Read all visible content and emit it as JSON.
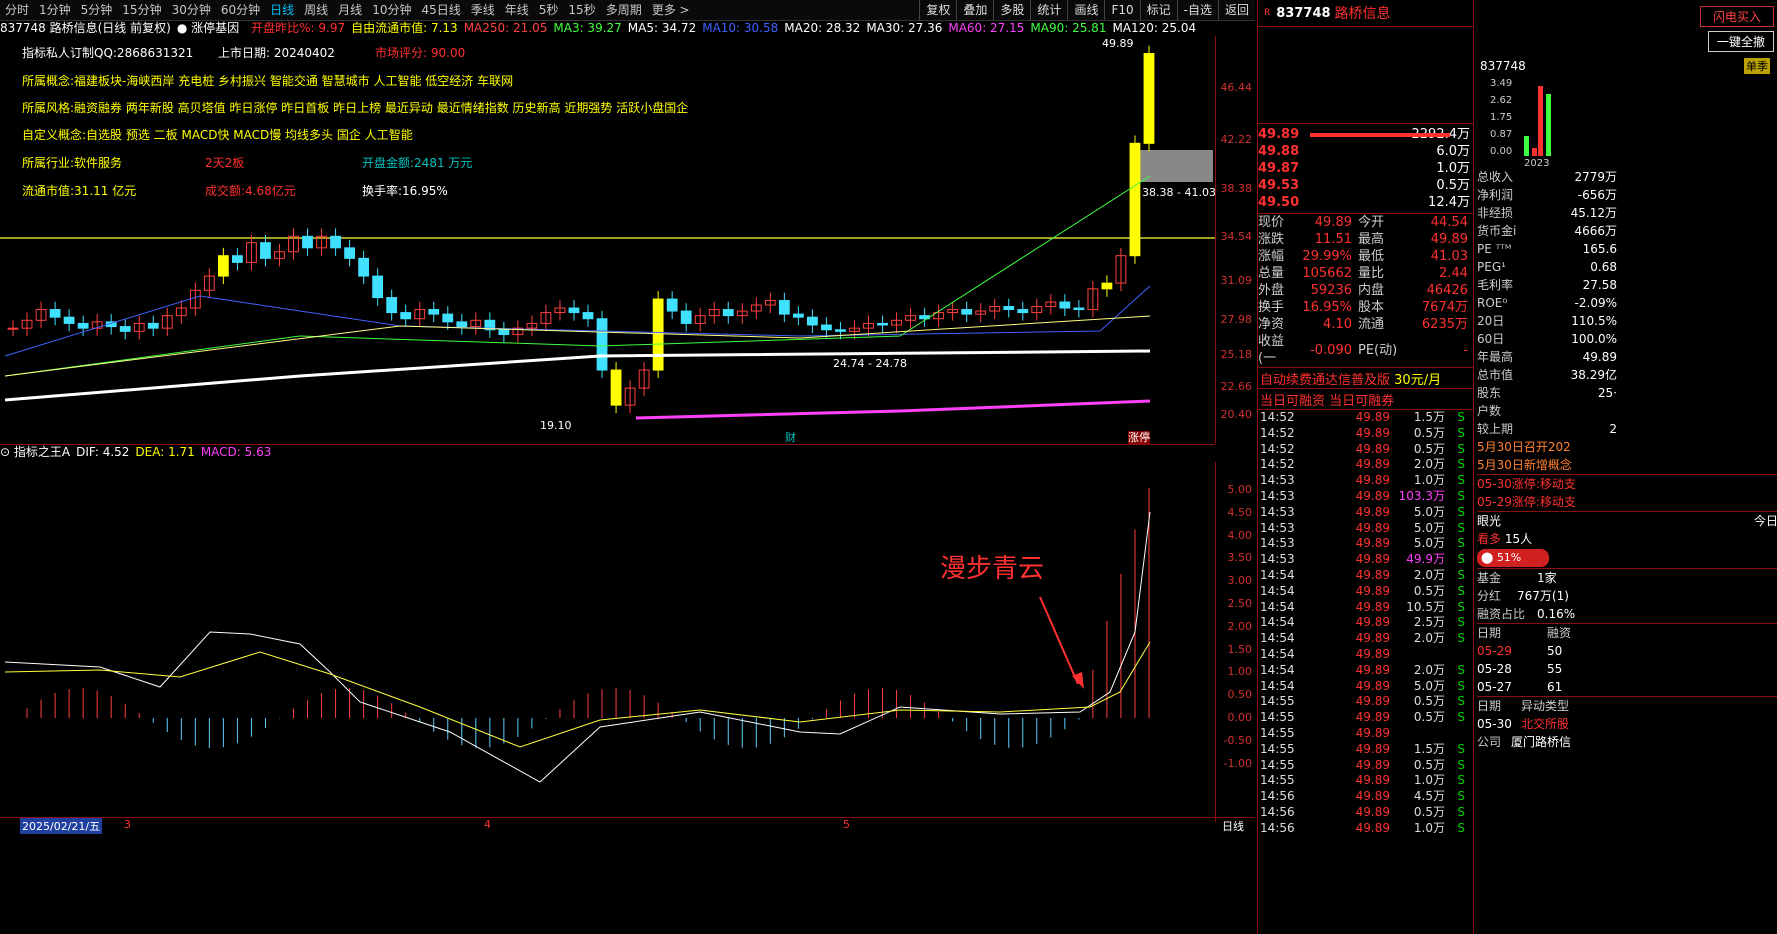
{
  "toolbar": {
    "periods": [
      "分时",
      "1分钟",
      "5分钟",
      "15分钟",
      "30分钟",
      "60分钟",
      "日线",
      "周线",
      "月线",
      "10分钟",
      "45日线",
      "季线",
      "年线",
      "5秒",
      "15秒",
      "多周期",
      "更多 >"
    ],
    "active_period": "日线",
    "tools": [
      "复权",
      "叠加",
      "多股",
      "统计",
      "画线",
      "F10",
      "标记",
      "-自选",
      "返回"
    ]
  },
  "header": {
    "stock_title": "837748 路桥信息(日线 前复权)",
    "limit_base": "涨停基因",
    "open_ratio": "开盘昨比%: 9.97",
    "float_cap": "自由流通市值: 7.13",
    "ma": [
      {
        "label": "MA250: 21.05",
        "color": "#ff4040"
      },
      {
        "label": "MA3: 39.27",
        "color": "#40ff40"
      },
      {
        "label": "MA5: 34.72",
        "color": "#ffffff"
      },
      {
        "label": "MA10: 30.58",
        "color": "#4060ff"
      },
      {
        "label": "MA20: 28.32",
        "color": "#ffffff"
      },
      {
        "label": "MA30: 27.36",
        "color": "#ffffff"
      },
      {
        "label": "MA60: 27.15",
        "color": "#ff40ff"
      },
      {
        "label": "MA90: 25.81",
        "color": "#40ff40"
      },
      {
        "label": "MA120: 25.04",
        "color": "#ffffff"
      }
    ]
  },
  "info": {
    "custom": "指标私人订制QQ:2868631321",
    "list_date": "上市日期: 20240402",
    "score": "市场评分: 90.00",
    "concept": "所属概念:福建板块-海峡西岸 充电桩 乡村振兴 智能交通 智慧城市 人工智能 低空经济 车联网",
    "style": "所属风格:融资融券 两年新股 高贝塔值 昨日涨停 昨日首板 昨日上榜 最近异动 最近情绪指数 历史新高 近期强势 活跃小盘国企",
    "custom_concept": "自定义概念:自选股 预选 二板 MACD快 MACD慢 均线多头 国企 人工智能",
    "industry": "所属行业:软件服务",
    "boards": "2天2板",
    "open_amount": "开盘金额:2481 万元",
    "float_value": "流通市值:31.11 亿元",
    "turnover_amount": "成交额:4.68亿元",
    "turnover_rate": "换手率:16.95%"
  },
  "chart_data": [
    {
      "type": "candlestick",
      "title": "837748 路桥信息(日线 前复权)",
      "yticks": [
        "46.44",
        "42.22",
        "38.38",
        "34.54",
        "31.09",
        "27.98",
        "25.18",
        "22.66",
        "20.40"
      ],
      "annotations": [
        "49.89",
        "38.38 - 41.03",
        "24.74 - 24.78",
        "19.10",
        "财",
        "涨停"
      ],
      "high_label": "49.89",
      "low_label": "19.10",
      "range_label": "38.38 - 41.03",
      "mid_label": "24.74 - 24.78",
      "cai_label": "财",
      "zt_label": "涨停"
    },
    {
      "type": "bar",
      "title": "指标之王A",
      "dif": "DIF: 4.52",
      "dea": "DEA: 1.71",
      "macd": "MACD: 5.63",
      "yticks": [
        "5.00",
        "4.50",
        "4.00",
        "3.50",
        "3.00",
        "2.50",
        "2.00",
        "1.50",
        "1.00",
        "0.50",
        "0.00",
        "-0.50",
        "-1.00"
      ],
      "annotation": "漫步青云"
    }
  ],
  "xaxis": {
    "date": "2025/02/21/五",
    "m3": "3",
    "m4": "4",
    "m5": "5",
    "right": "日线"
  },
  "panel": {
    "code": "837748",
    "name": "路桥信息",
    "order_book": [
      {
        "price": "49.89",
        "vol": "2292.4万"
      },
      {
        "price": "49.88",
        "vol": "6.0万"
      },
      {
        "price": "49.87",
        "vol": "1.0万"
      },
      {
        "price": "49.53",
        "vol": "0.5万"
      },
      {
        "price": "49.50",
        "vol": "12.4万"
      }
    ],
    "quote": [
      {
        "l": "现价",
        "v": "49.89",
        "l2": "今开",
        "v2": "44.54"
      },
      {
        "l": "涨跌",
        "v": "11.51",
        "l2": "最高",
        "v2": "49.89"
      },
      {
        "l": "涨幅",
        "v": "29.99%",
        "l2": "最低",
        "v2": "41.03"
      },
      {
        "l": "总量",
        "v": "105662",
        "l2": "量比",
        "v2": "2.44"
      },
      {
        "l": "外盘",
        "v": "59236",
        "l2": "内盘",
        "v2": "46426"
      },
      {
        "l": "换手",
        "v": "16.95%",
        "l2": "股本",
        "v2": "7674万"
      },
      {
        "l": "净资",
        "v": "4.10",
        "l2": "流通",
        "v2": "6235万"
      },
      {
        "l": "收益(一",
        "v": "-0.090",
        "l2": "PE(动)",
        "v2": "-"
      }
    ],
    "ad": "自动续费通达信普及版",
    "ad_price": "30元/月",
    "margin_tabs": [
      "当日可融资",
      "当日可融券"
    ],
    "ticks": [
      {
        "t": "14:52",
        "p": "49.89",
        "v": "1.5万",
        "s": "S"
      },
      {
        "t": "14:52",
        "p": "49.89",
        "v": "0.5万",
        "s": "S"
      },
      {
        "t": "14:52",
        "p": "49.89",
        "v": "0.5万",
        "s": "S"
      },
      {
        "t": "14:52",
        "p": "49.89",
        "v": "2.0万",
        "s": "S"
      },
      {
        "t": "14:53",
        "p": "49.89",
        "v": "1.0万",
        "s": "S"
      },
      {
        "t": "14:53",
        "p": "49.89",
        "v": "103.3万",
        "s": "S"
      },
      {
        "t": "14:53",
        "p": "49.89",
        "v": "5.0万",
        "s": "S"
      },
      {
        "t": "14:53",
        "p": "49.89",
        "v": "5.0万",
        "s": "S"
      },
      {
        "t": "14:53",
        "p": "49.89",
        "v": "5.0万",
        "s": "S"
      },
      {
        "t": "14:53",
        "p": "49.89",
        "v": "49.9万",
        "s": "S"
      },
      {
        "t": "14:54",
        "p": "49.89",
        "v": "2.0万",
        "s": "S"
      },
      {
        "t": "14:54",
        "p": "49.89",
        "v": "0.5万",
        "s": "S"
      },
      {
        "t": "14:54",
        "p": "49.89",
        "v": "10.5万",
        "s": "S"
      },
      {
        "t": "14:54",
        "p": "49.89",
        "v": "2.5万",
        "s": "S"
      },
      {
        "t": "14:54",
        "p": "49.89",
        "v": "2.0万",
        "s": "S"
      },
      {
        "t": "14:54",
        "p": "49.89",
        "v": "",
        "s": ""
      },
      {
        "t": "14:54",
        "p": "49.89",
        "v": "2.0万",
        "s": "S"
      },
      {
        "t": "14:54",
        "p": "49.89",
        "v": "5.0万",
        "s": "S"
      },
      {
        "t": "14:55",
        "p": "49.89",
        "v": "0.5万",
        "s": "S"
      },
      {
        "t": "14:55",
        "p": "49.89",
        "v": "0.5万",
        "s": "S"
      },
      {
        "t": "14:55",
        "p": "49.89",
        "v": "",
        "s": ""
      },
      {
        "t": "14:55",
        "p": "49.89",
        "v": "1.5万",
        "s": "S"
      },
      {
        "t": "14:55",
        "p": "49.89",
        "v": "0.5万",
        "s": "S"
      },
      {
        "t": "14:55",
        "p": "49.89",
        "v": "1.0万",
        "s": "S"
      },
      {
        "t": "14:56",
        "p": "49.89",
        "v": "4.5万",
        "s": "S"
      },
      {
        "t": "14:56",
        "p": "49.89",
        "v": "0.5万",
        "s": "S"
      },
      {
        "t": "14:56",
        "p": "49.89",
        "v": "1.0万",
        "s": "S"
      }
    ]
  },
  "rpanel": {
    "flash_buy": "闪电买入",
    "one_click_sell": "一键全撤",
    "code": "837748",
    "season": "单季",
    "mini_yticks": [
      "3.49",
      "2.62",
      "1.75",
      "0.87",
      "0.00"
    ],
    "year": "2023",
    "fin": [
      {
        "l": "总收入",
        "v": "2779万"
      },
      {
        "l": "净利润",
        "v": "-656万"
      },
      {
        "l": "非经损",
        "v": "45.12万"
      },
      {
        "l": "货币金i",
        "v": "4666万"
      },
      {
        "l": "PE ᵀᵀᴹ",
        "v": "165.6"
      },
      {
        "l": "PEG¹",
        "v": "0.68"
      },
      {
        "l": "毛利率",
        "v": "27.58"
      },
      {
        "l": "ROE⁰",
        "v": "-2.09%"
      },
      {
        "l": "20日",
        "v": "110.5%"
      },
      {
        "l": "60日",
        "v": "100.0%"
      },
      {
        "l": "年最高",
        "v": "49.89"
      },
      {
        "l": "总市值",
        "v": "38.29亿"
      },
      {
        "l": "股东",
        "v": "25·"
      },
      {
        "l": "户数",
        "v": ""
      },
      {
        "l": "较上期",
        "v": "2"
      }
    ],
    "news": [
      "5月30日召开202",
      "5月30日新增概念"
    ],
    "limits": [
      "05-30涨停:移动支",
      "05-29涨停:移动支"
    ],
    "eye_label": "眼光",
    "eye_right": "今日",
    "bull_label": "看多",
    "bull_count": "15人",
    "bull_pct": "51%",
    "fund_label": "基金",
    "fund_value": "1家",
    "div_label": "分红",
    "div_value": "767万(1)",
    "margin_label": "融资占比",
    "margin_value": "0.16%",
    "margin_head": [
      "日期",
      "融资"
    ],
    "margin_rows": [
      {
        "d": "05-29",
        "v": "50"
      },
      {
        "d": "05-28",
        "v": "55"
      },
      {
        "d": "05-27",
        "v": "61"
      }
    ],
    "abnormal_head": [
      "日期",
      "异动类型"
    ],
    "abnormal_row": {
      "d": "05-30",
      "v": "北交所股"
    },
    "company_label": "公司",
    "company_value": "厦门路桥信"
  }
}
